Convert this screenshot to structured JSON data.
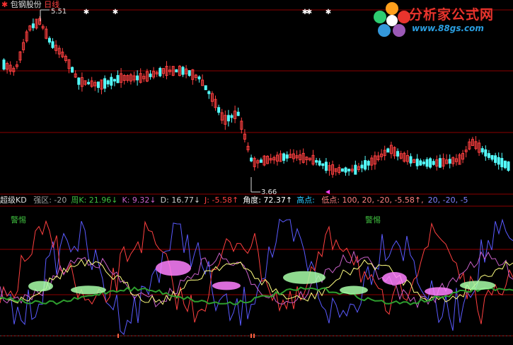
{
  "header": {
    "stock_name": "包钢股份",
    "period": "日线",
    "high_marker": "5.51",
    "low_marker": "3.66"
  },
  "logo": {
    "title": "分析家公式网",
    "url": "www.88gs.com"
  },
  "indicator": {
    "name": "超级KD",
    "items": [
      {
        "label": "强区",
        "value": "-20",
        "color": "#a0a0a0"
      },
      {
        "label": "周K",
        "value": "21.96↓",
        "color": "#3fbf3f"
      },
      {
        "label": "K",
        "value": "9.32↓",
        "color": "#c860c8"
      },
      {
        "label": "D",
        "value": "16.77↓",
        "color": "#cccccc"
      },
      {
        "label": "J",
        "value": "-5.58↑",
        "color": "#ff4040"
      },
      {
        "label": "角度",
        "value": "72.37↑",
        "color": "#ffffff"
      },
      {
        "label": "高点",
        "value": "",
        "color": "#29c7ff"
      },
      {
        "label": "低点",
        "value": "100, 20, -20, -5.58↑,",
        "color": "#ff8080"
      },
      {
        "label": "",
        "value": "20, -20, -5",
        "color": "#8080ff"
      }
    ],
    "warning_label": "警惕"
  },
  "colors": {
    "up": "#ff4040",
    "down": "#54ffff",
    "grid": "#8b0000"
  }
}
